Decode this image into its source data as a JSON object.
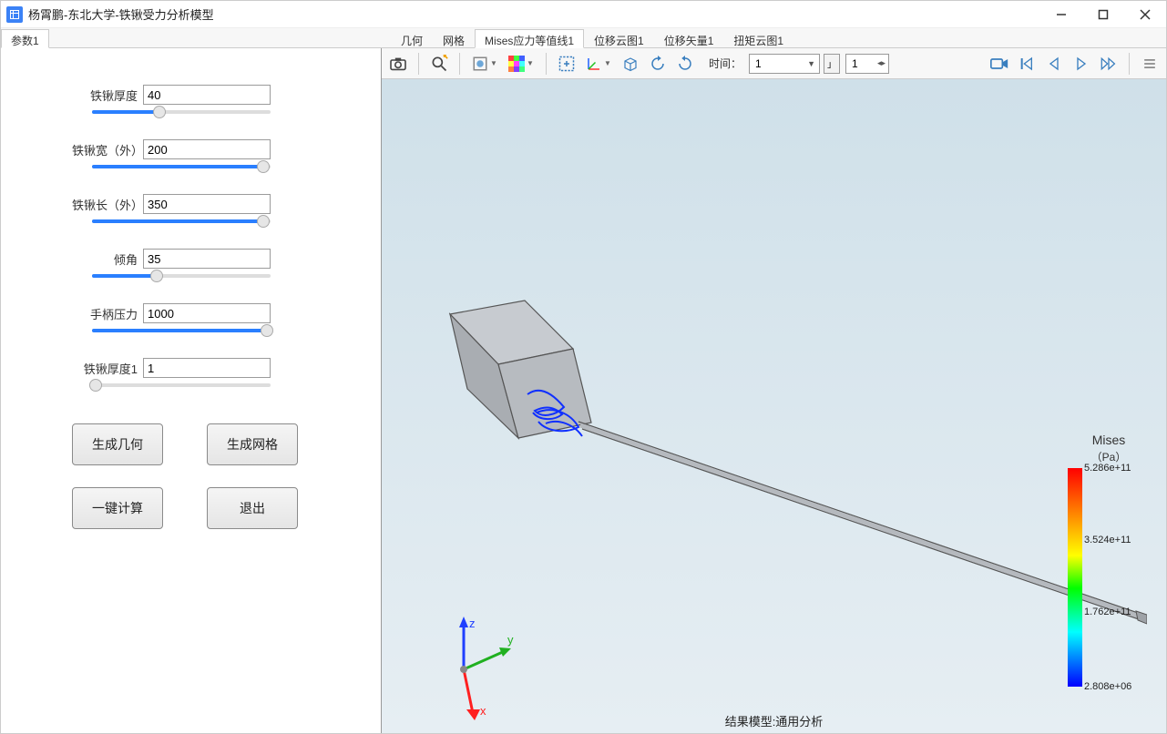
{
  "window": {
    "title": "杨霄鹏-东北大学-铁锹受力分析模型"
  },
  "leftTabs": [
    {
      "label": "参数1",
      "active": true
    }
  ],
  "rightTabs": [
    {
      "label": "几何",
      "active": false
    },
    {
      "label": "网格",
      "active": false
    },
    {
      "label": "Mises应力等值线1",
      "active": true
    },
    {
      "label": "位移云图1",
      "active": false
    },
    {
      "label": "位移矢量1",
      "active": false
    },
    {
      "label": "扭矩云图1",
      "active": false
    }
  ],
  "params": [
    {
      "label": "铁锹厚度",
      "value": "40",
      "sliderPct": 38
    },
    {
      "label": "铁锹宽（外）",
      "value": "200",
      "sliderPct": 96
    },
    {
      "label": "铁锹长（外）",
      "value": "350",
      "sliderPct": 96
    },
    {
      "label": "倾角",
      "value": "35",
      "sliderPct": 36
    },
    {
      "label": "手柄压力",
      "value": "1000",
      "sliderPct": 98
    },
    {
      "label": "铁锹厚度1",
      "value": "1",
      "sliderPct": 2
    }
  ],
  "buttons": {
    "gen_geom": "生成几何",
    "gen_mesh": "生成网格",
    "compute": "一键计算",
    "exit": "退出"
  },
  "toolbar": {
    "time_label": "时间：",
    "time_value": "1",
    "frame_value": "1"
  },
  "legend": {
    "title": "Mises",
    "unit": "（Pa）",
    "ticks": [
      {
        "label": "5.286e+11",
        "pct": 0
      },
      {
        "label": "3.524e+11",
        "pct": 33
      },
      {
        "label": "1.762e+11",
        "pct": 66
      },
      {
        "label": "2.808e+06",
        "pct": 100
      }
    ]
  },
  "status": "结果模型:通用分析",
  "triad": {
    "x": "x",
    "y": "y",
    "z": "z"
  }
}
